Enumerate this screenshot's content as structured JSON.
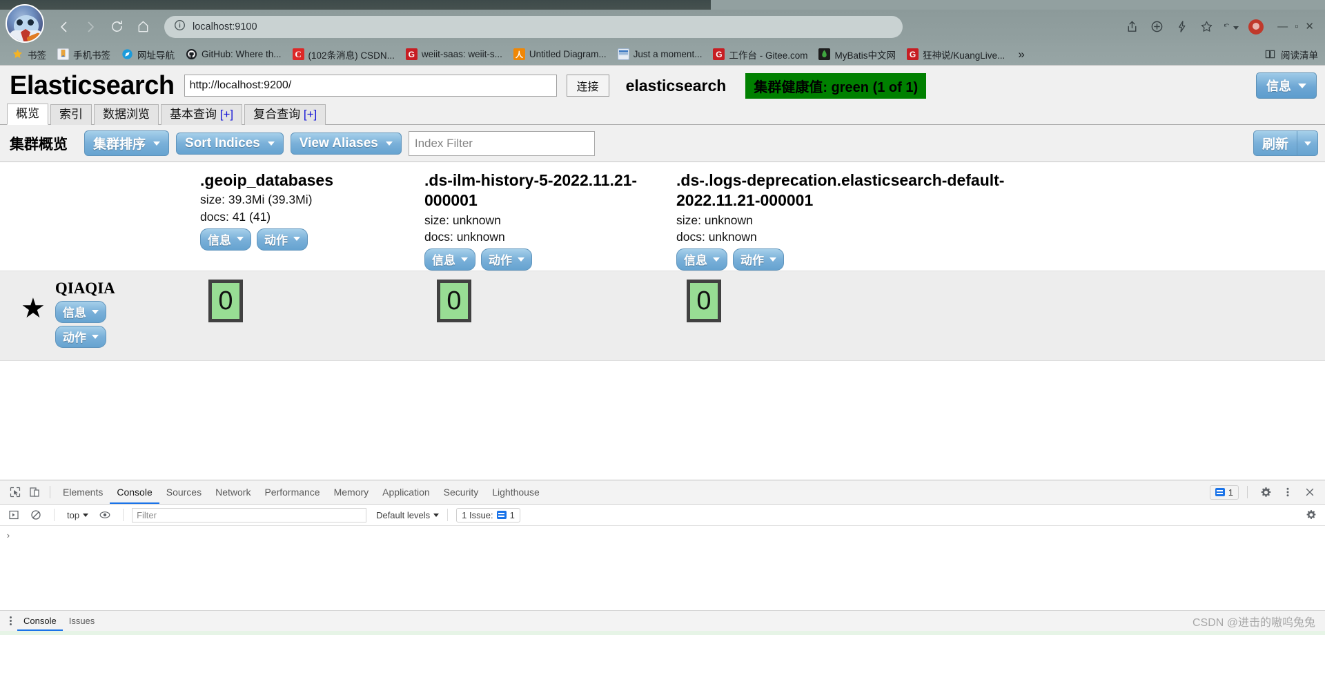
{
  "browser": {
    "url_text": "localhost:9100",
    "nav": {
      "back": "back-button",
      "forward": "forward-button",
      "reload": "reload-button",
      "home": "home-button"
    },
    "bookmarks": [
      {
        "label": "书签",
        "icon": "star-icon",
        "color": "#f5b324"
      },
      {
        "label": "手机书签",
        "icon": "bookmark-icon",
        "color": "#e8eaf0"
      },
      {
        "label": "网址导航",
        "icon": "compass-icon",
        "color": "#1b9bdb"
      },
      {
        "label": "GitHub: Where th...",
        "icon": "github-icon",
        "color": "#24292e"
      },
      {
        "label": "(102条消息) CSDN...",
        "icon": "csdn-icon",
        "color": "#dd2727"
      },
      {
        "label": "weiit-saas: weiit-s...",
        "icon": "gitee-red-icon",
        "color": "#c71d23"
      },
      {
        "label": "Untitled Diagram...",
        "icon": "drawio-icon",
        "color": "#f08705"
      },
      {
        "label": "Just a moment...",
        "icon": "window-icon",
        "color": "#3b78c2"
      },
      {
        "label": "工作台 - Gitee.com",
        "icon": "gitee-icon",
        "color": "#c71d23"
      },
      {
        "label": "MyBatis中文网",
        "icon": "mybatis-icon",
        "color": "#2f6f2f"
      },
      {
        "label": "狂神说/KuangLive...",
        "icon": "gitee-icon",
        "color": "#c71d23"
      }
    ],
    "bookmarks_overflow": "»",
    "reading_list": "阅读清单",
    "reading_list_icon": "reading-list-icon"
  },
  "es": {
    "logo": "Elasticsearch",
    "url_value": "http://localhost:9200/",
    "url_placeholder": "http://localhost:9200/",
    "connect_label": "连接",
    "cluster_name": "elasticsearch",
    "health_badge": "集群健康值: green (1 of 1)",
    "health_color": "#008000",
    "info_button": "信息",
    "tabs": [
      {
        "label": "概览",
        "plus": "",
        "active": true
      },
      {
        "label": "索引",
        "plus": "",
        "active": false
      },
      {
        "label": "数据浏览",
        "plus": "",
        "active": false
      },
      {
        "label": "基本查询",
        "plus": "[+]",
        "active": false
      },
      {
        "label": "复合查询",
        "plus": "[+]",
        "active": false
      }
    ],
    "toolbar": {
      "title": "集群概览",
      "sort_cluster": "集群排序",
      "sort_indices": "Sort Indices",
      "view_aliases": "View Aliases",
      "filter_placeholder": "Index Filter",
      "filter_value": "",
      "refresh": "刷新"
    },
    "indices": [
      {
        "name": ".geoip_databases",
        "size": "size: 39.3Mi (39.3Mi)",
        "docs": "docs: 41 (41)",
        "info_label": "信息",
        "action_label": "动作",
        "shard": "0"
      },
      {
        "name": ".ds-ilm-history-5-2022.11.21-000001",
        "size": "size: unknown",
        "docs": "docs: unknown",
        "info_label": "信息",
        "action_label": "动作",
        "shard": "0"
      },
      {
        "name": ".ds-.logs-deprecation.elasticsearch-default-2022.11.21-000001",
        "size": "size: unknown",
        "docs": "docs: unknown",
        "info_label": "信息",
        "action_label": "动作",
        "shard": "0"
      }
    ],
    "node": {
      "star_icon": "star-filled-icon",
      "name": "QIAQIA",
      "info_label": "信息",
      "action_label": "动作"
    },
    "shard_color": "#98dd94"
  },
  "devtools": {
    "inspect_icon": "inspect-element-icon",
    "device_icon": "device-toolbar-icon",
    "tabs": [
      {
        "label": "Elements",
        "active": false
      },
      {
        "label": "Console",
        "active": true
      },
      {
        "label": "Sources",
        "active": false
      },
      {
        "label": "Network",
        "active": false
      },
      {
        "label": "Performance",
        "active": false
      },
      {
        "label": "Memory",
        "active": false
      },
      {
        "label": "Application",
        "active": false
      },
      {
        "label": "Security",
        "active": false
      },
      {
        "label": "Lighthouse",
        "active": false
      }
    ],
    "issue_count_top": "1",
    "settings_icon": "gear-icon",
    "more_icon": "more-vertical-icon",
    "close_icon": "close-icon",
    "console": {
      "execute_icon": "execute-snippet-icon",
      "clear_icon": "clear-console-icon",
      "context": "top",
      "eye_icon": "live-expression-icon",
      "filter_placeholder": "Filter",
      "filter_value": "",
      "levels": "Default levels",
      "issues": "1 Issue:",
      "issues_count": "1",
      "prompt": "›"
    },
    "drawer": {
      "tabs": [
        {
          "label": "Console",
          "active": true
        },
        {
          "label": "Issues",
          "active": false
        }
      ],
      "more_icon": "more-vertical-icon"
    }
  },
  "watermark": "CSDN @进击的嗷呜兔兔"
}
